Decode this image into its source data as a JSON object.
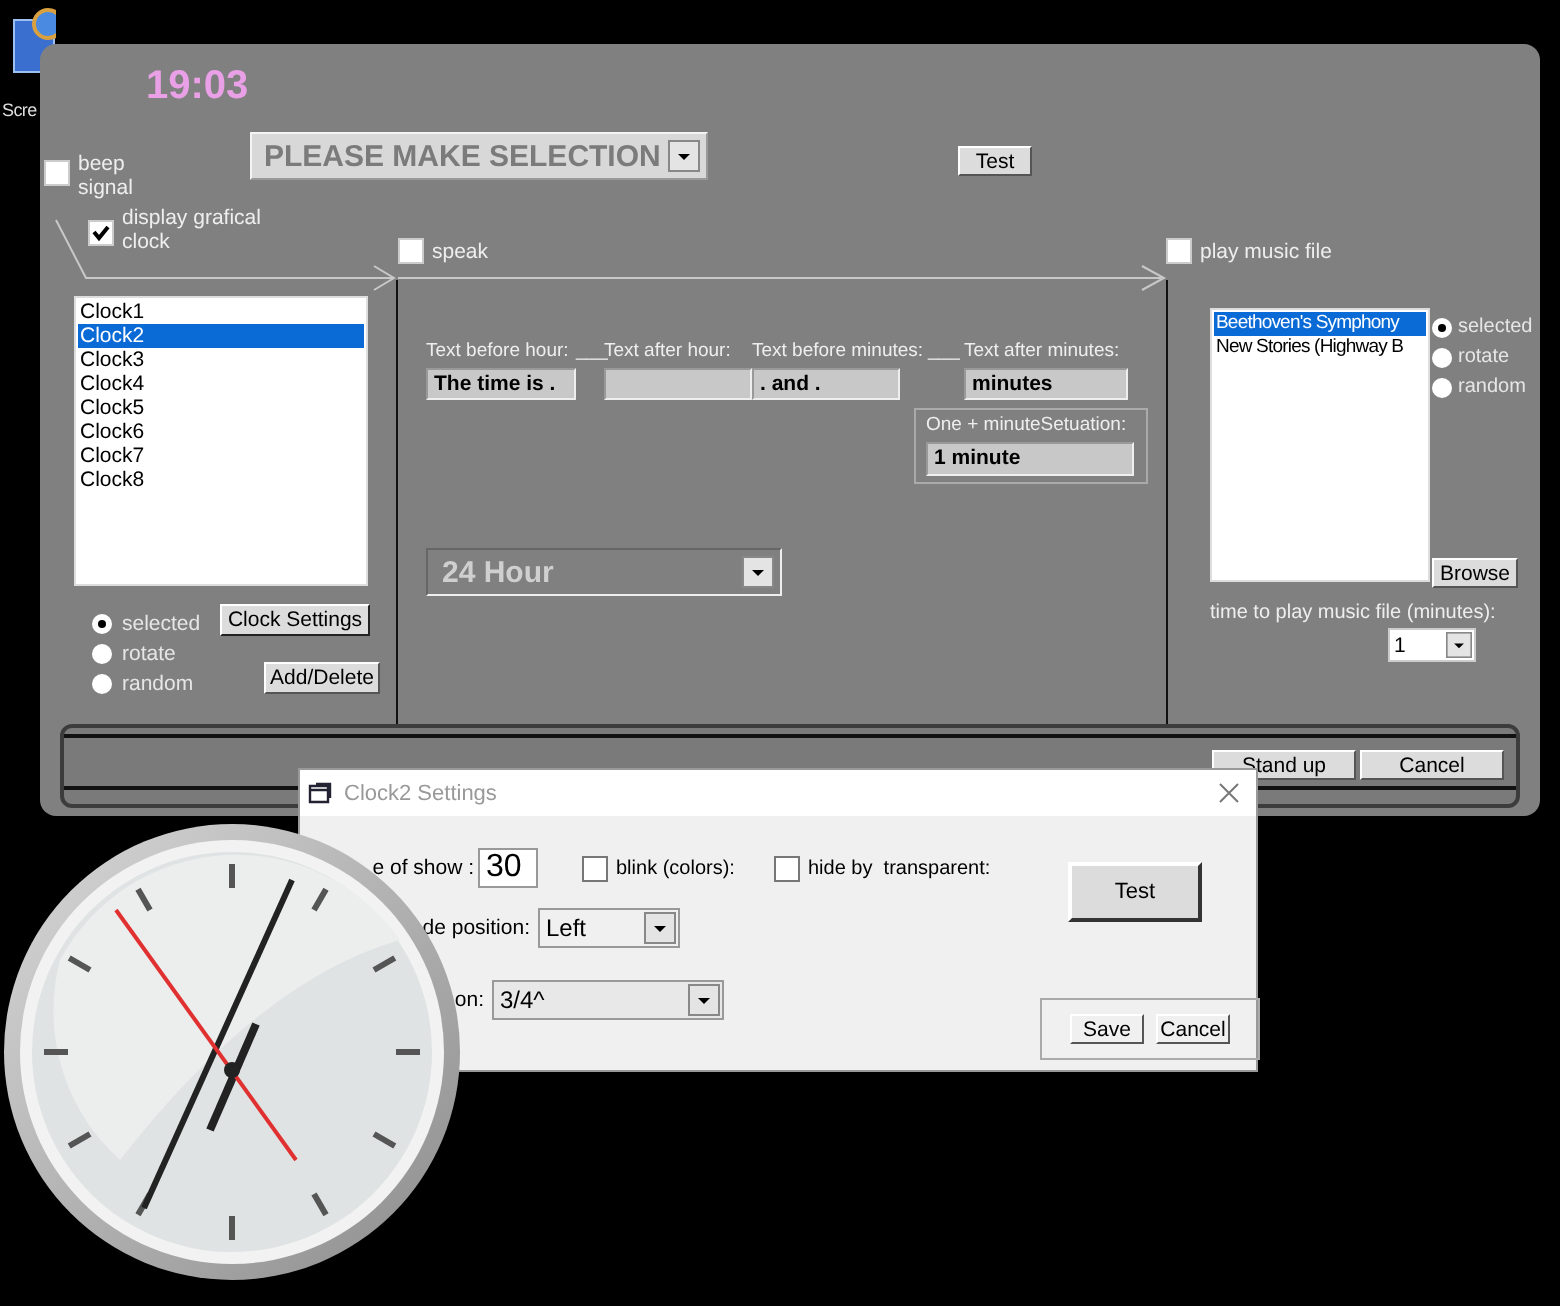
{
  "desktop_icon": {
    "label": "Scre"
  },
  "main_window": {
    "time": "19:03",
    "beep_signal": {
      "label": "beep signal",
      "checked": false
    },
    "selection": {
      "value": "PLEASE MAKE SELECTION"
    },
    "test_button": "Test",
    "display_clock": {
      "label": "display grafical clock",
      "checked": true
    },
    "speak": {
      "label": "speak",
      "checked": false
    },
    "play_music": {
      "label": "play music file",
      "checked": false
    },
    "clocks": {
      "items": [
        {
          "label": "Clock1",
          "selected": false
        },
        {
          "label": "Clock2",
          "selected": true
        },
        {
          "label": "Clock3",
          "selected": false
        },
        {
          "label": "Clock4",
          "selected": false
        },
        {
          "label": "Clock5",
          "selected": false
        },
        {
          "label": "Clock6",
          "selected": false
        },
        {
          "label": "Clock7",
          "selected": false
        },
        {
          "label": "Clock8",
          "selected": false
        }
      ],
      "modes": [
        {
          "label": "selected",
          "selected": true
        },
        {
          "label": "rotate",
          "selected": false
        },
        {
          "label": "random",
          "selected": false
        }
      ],
      "settings_button": "Clock Settings",
      "add_delete_button": "Add/Delete"
    },
    "speech": {
      "labels": [
        "Text before hour:",
        "___",
        "Text after hour:",
        "Text before minutes:",
        "___",
        "Text after minutes:"
      ],
      "before_hour": "The time is .",
      "before_minutes": ". and .",
      "after_minutes": "minutes",
      "one_minute": {
        "label": "One + minuteSetuation:",
        "value": "1 minute"
      },
      "hour_format": "24 Hour"
    },
    "music": {
      "items": [
        {
          "label": "Beethoven's Symphony",
          "selected": true
        },
        {
          "label": "New Stories (Highway B",
          "selected": false
        }
      ],
      "modes": [
        {
          "label": "selected",
          "selected": true
        },
        {
          "label": "rotate",
          "selected": false
        },
        {
          "label": "random",
          "selected": false
        }
      ],
      "browse_button": "Browse",
      "time_label": "time to play music file (minutes):",
      "time_value": "1"
    },
    "footer_buttons": [
      "Stand up",
      "Cancel"
    ]
  },
  "settings_dialog": {
    "title": "Clock2 Settings",
    "show_label": "e of show :",
    "show_value": "30",
    "blink": {
      "label": "blink (colors):",
      "checked": false
    },
    "hide": {
      "label": "hide by  transparent:",
      "checked": false
    },
    "test_button": "Test",
    "position_label": "de position:",
    "position_value": "Left",
    "size_label": "on:",
    "size_value": "3/4^",
    "buttons": [
      "Save",
      "Cancel"
    ]
  }
}
